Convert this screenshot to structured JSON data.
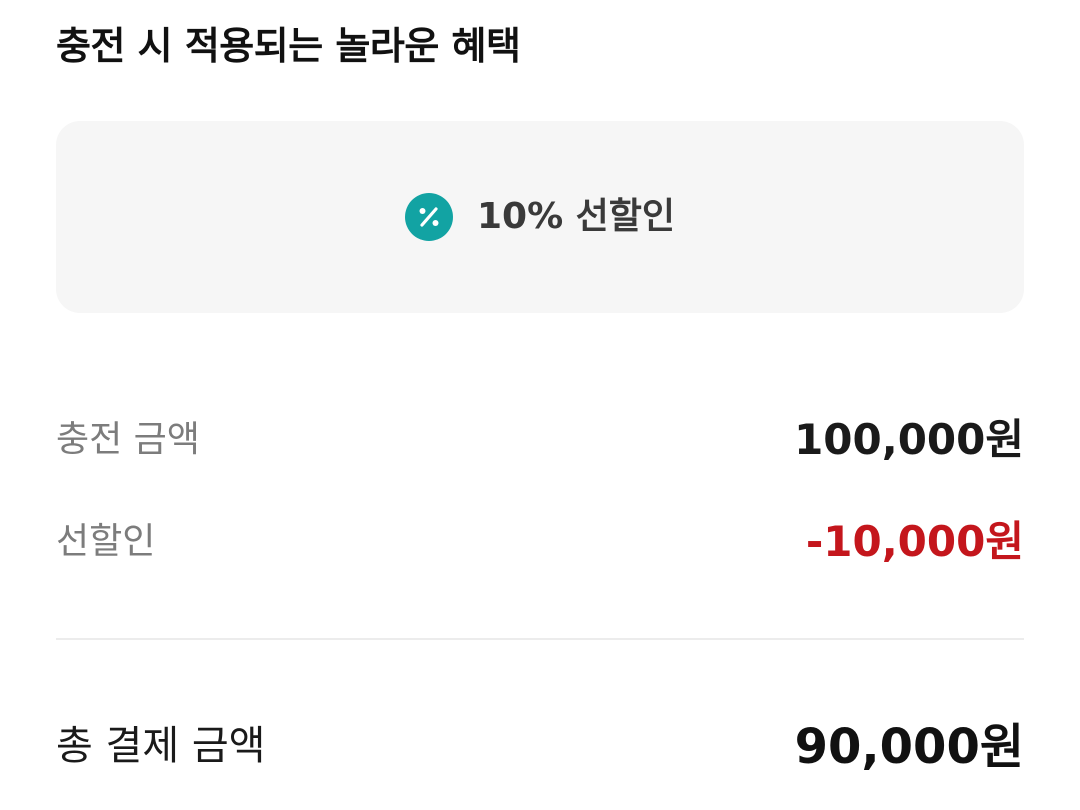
{
  "section": {
    "title": "충전 시 적용되는 놀라운 혜택"
  },
  "benefit": {
    "icon": "percent-icon",
    "icon_color": "#12a3a3",
    "label": "10% 선할인"
  },
  "summary": {
    "charge_label": "충전 금액",
    "charge_value": "100,000원",
    "discount_label": "선할인",
    "discount_value": "-10,000원",
    "discount_color": "#c4161c",
    "total_label": "총 결제 금액",
    "total_value": "90,000원"
  }
}
